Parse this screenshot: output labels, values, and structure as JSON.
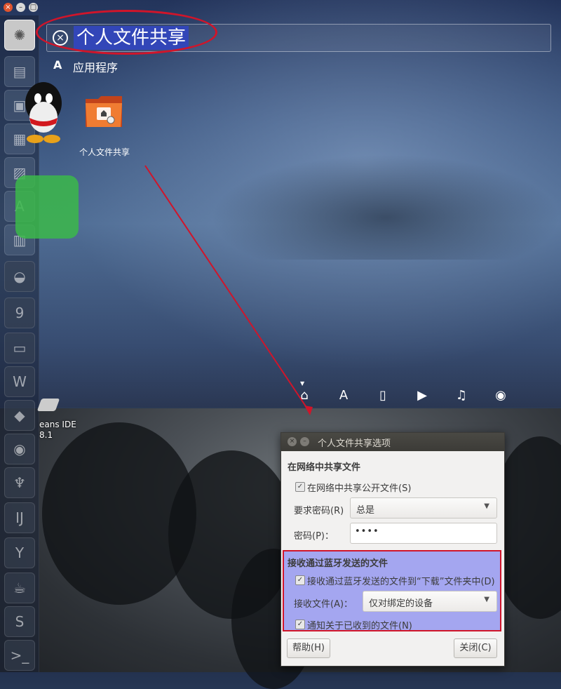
{
  "search": {
    "query": "个人文件共享"
  },
  "results": {
    "category_label": "应用程序",
    "category_icon": "app-store-icon",
    "app": {
      "label": "个人文件共享",
      "icon": "folder-share-icon"
    }
  },
  "lenses": [
    "home-lens-icon",
    "applications-lens-icon",
    "files-lens-icon",
    "video-lens-icon",
    "music-lens-icon",
    "photo-lens-icon"
  ],
  "desktop": {
    "label_line1": "eans IDE",
    "label_line2": "8.1"
  },
  "dialog": {
    "title": "个人文件共享选项",
    "section_network": "在网络中共享文件",
    "share_public_label": "在网络中共享公开文件(S)",
    "require_password_label": "要求密码(R)",
    "require_password_value": "总是",
    "password_label": "密码(P)：",
    "password_value": "••••",
    "section_bluetooth": "接收通过蓝牙发送的文件",
    "receive_download_label": "接收通过蓝牙发送的文件到“下载”文件夹中(D)",
    "receive_files_label": "接收文件(A)：",
    "receive_files_value": "仅对绑定的设备",
    "notify_label": "通知关于已收到的文件(N)",
    "help_button": "帮助(H)",
    "close_button": "关闭(C)"
  },
  "colors": {
    "accent_red": "#d0152a",
    "highlight": "#a4a6f0",
    "search_selection": "#3246b8"
  }
}
